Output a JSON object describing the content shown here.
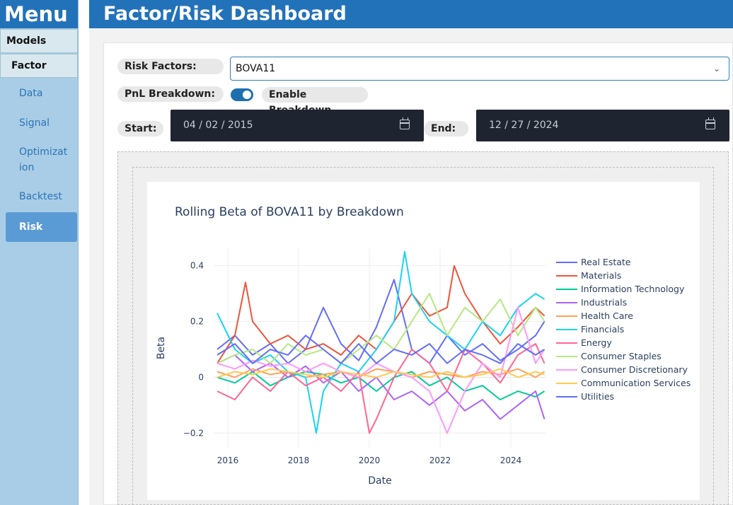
{
  "sidebar": {
    "menu_title": "Menu",
    "models_label": "Models",
    "factor_label": "Factor",
    "items": [
      {
        "label": "Data"
      },
      {
        "label": "Signal"
      },
      {
        "label": "Optimizat\nion"
      },
      {
        "label": "Backtest"
      }
    ],
    "active_item": "Risk"
  },
  "header": {
    "title": "Factor/Risk Dashboard"
  },
  "controls": {
    "risk_factors_label": "Risk Factors:",
    "risk_factor_value": "BOVA11",
    "pnl_label": "PnL Breakdown:",
    "enable_label": "Enable Breakdown",
    "toggle_on": true,
    "start_label": "Start:",
    "start_value": "04 / 02 / 2015",
    "end_label": "End:",
    "end_value": "12 / 27 / 2024"
  },
  "icons": {
    "select": "chevron-down-icon",
    "start_date": "calendar-icon",
    "end_date": "calendar-icon"
  },
  "colors": {
    "accent": "#2272b9",
    "sidebar": "#a9cde6",
    "active_item": "#5b9bd5",
    "date_input": "#1f2530"
  },
  "chart_data": {
    "type": "line",
    "title": "Rolling Beta of BOVA11 by Breakdown",
    "xlabel": "Date",
    "ylabel": "Beta",
    "xlim": [
      2015.6,
      2025.0
    ],
    "ylim": [
      -0.25,
      0.46
    ],
    "x_ticks": [
      2016,
      2018,
      2020,
      2022,
      2024
    ],
    "y_ticks": [
      0.4,
      0.2,
      0,
      -0.2
    ],
    "y_tick_labels": [
      "0.4",
      "0.2",
      "0",
      "−0.2"
    ],
    "grid": true,
    "legend_position": "right",
    "series": [
      {
        "name": "Real Estate",
        "color": "#636efa",
        "x": [
          2015.7,
          2016.2,
          2016.7,
          2017.2,
          2017.7,
          2018.2,
          2018.7,
          2019.2,
          2019.7,
          2020.2,
          2020.7,
          2021.2,
          2021.7,
          2022.2,
          2022.7,
          2023.2,
          2023.7,
          2024.2,
          2024.7,
          2024.95
        ],
        "values": [
          0.1,
          0.15,
          0.08,
          0.12,
          0.05,
          0.1,
          0.25,
          0.12,
          0.06,
          0.18,
          0.35,
          0.1,
          0.05,
          0.15,
          0.08,
          0.12,
          0.06,
          0.1,
          0.15,
          0.2
        ]
      },
      {
        "name": "Materials",
        "color": "#ef553b",
        "x": [
          2015.7,
          2016.2,
          2016.5,
          2016.7,
          2017.2,
          2017.7,
          2018.2,
          2018.7,
          2019.2,
          2019.7,
          2020.2,
          2020.7,
          2021.2,
          2021.7,
          2022.2,
          2022.4,
          2022.7,
          2023.2,
          2023.7,
          2024.2,
          2024.7,
          2024.95
        ],
        "values": [
          0.05,
          0.15,
          0.34,
          0.2,
          0.12,
          0.15,
          0.1,
          0.12,
          0.08,
          0.15,
          0.1,
          0.2,
          0.3,
          0.22,
          0.25,
          0.4,
          0.3,
          0.2,
          0.12,
          0.18,
          0.25,
          0.22
        ]
      },
      {
        "name": "Information Technology",
        "color": "#00cc96",
        "x": [
          2015.7,
          2016.2,
          2016.7,
          2017.2,
          2017.7,
          2018.2,
          2018.7,
          2019.2,
          2019.7,
          2020.2,
          2020.7,
          2021.2,
          2021.7,
          2022.2,
          2022.7,
          2023.2,
          2023.7,
          2024.2,
          2024.7,
          2024.95
        ],
        "values": [
          0.0,
          -0.02,
          0.02,
          -0.03,
          0.0,
          0.02,
          0.01,
          -0.02,
          0.0,
          -0.05,
          0.0,
          0.02,
          -0.03,
          0.0,
          -0.05,
          -0.03,
          -0.08,
          -0.05,
          -0.07,
          -0.05
        ]
      },
      {
        "name": "Industrials",
        "color": "#ab63fa",
        "x": [
          2015.7,
          2016.2,
          2016.7,
          2017.2,
          2017.7,
          2018.2,
          2018.7,
          2019.2,
          2019.7,
          2020.2,
          2020.7,
          2021.2,
          2021.7,
          2022.2,
          2022.7,
          2023.2,
          2023.7,
          2024.2,
          2024.7,
          2024.95
        ],
        "values": [
          0.05,
          0.08,
          0.02,
          0.05,
          0.0,
          0.04,
          -0.02,
          0.02,
          -0.05,
          0.0,
          -0.08,
          -0.05,
          -0.1,
          -0.05,
          -0.12,
          -0.08,
          -0.15,
          -0.1,
          -0.05,
          -0.15
        ]
      },
      {
        "name": "Health Care",
        "color": "#ffa15a",
        "x": [
          2015.7,
          2016.2,
          2016.7,
          2017.2,
          2017.7,
          2018.2,
          2018.7,
          2019.2,
          2019.7,
          2020.2,
          2020.7,
          2021.2,
          2021.7,
          2022.2,
          2022.7,
          2023.2,
          2023.7,
          2024.2,
          2024.7,
          2024.95
        ],
        "values": [
          0.02,
          0.0,
          0.03,
          0.01,
          0.02,
          0.0,
          0.01,
          0.02,
          0.0,
          0.03,
          0.02,
          0.0,
          0.02,
          0.01,
          0.0,
          0.02,
          0.01,
          0.03,
          0.0,
          0.02
        ]
      },
      {
        "name": "Financials",
        "color": "#19d3f3",
        "x": [
          2015.7,
          2016.2,
          2016.7,
          2017.2,
          2017.7,
          2018.2,
          2018.5,
          2018.7,
          2019.2,
          2019.7,
          2020.2,
          2020.7,
          2021.0,
          2021.2,
          2021.7,
          2022.2,
          2022.7,
          2023.2,
          2023.7,
          2024.2,
          2024.7,
          2024.95
        ],
        "values": [
          0.23,
          0.1,
          0.05,
          0.08,
          0.02,
          0.0,
          -0.2,
          -0.05,
          0.05,
          0.02,
          0.1,
          0.2,
          0.45,
          0.3,
          0.2,
          0.15,
          0.1,
          0.2,
          0.15,
          0.25,
          0.3,
          0.28
        ]
      },
      {
        "name": "Energy",
        "color": "#ff6692",
        "x": [
          2015.7,
          2016.2,
          2016.7,
          2017.2,
          2017.7,
          2018.2,
          2018.7,
          2019.2,
          2019.7,
          2020.0,
          2020.2,
          2020.7,
          2021.2,
          2021.7,
          2022.2,
          2022.7,
          2023.2,
          2023.7,
          2024.2,
          2024.7,
          2024.95
        ],
        "values": [
          -0.05,
          -0.08,
          0.0,
          -0.05,
          0.02,
          -0.03,
          0.0,
          -0.05,
          0.02,
          -0.2,
          -0.15,
          0.0,
          0.1,
          0.05,
          -0.05,
          0.1,
          0.05,
          -0.02,
          0.08,
          0.12,
          0.05
        ]
      },
      {
        "name": "Consumer Staples",
        "color": "#b6e880",
        "x": [
          2015.7,
          2016.2,
          2016.7,
          2017.2,
          2017.7,
          2018.2,
          2018.7,
          2019.2,
          2019.7,
          2020.2,
          2020.7,
          2021.2,
          2021.7,
          2022.2,
          2022.7,
          2023.2,
          2023.7,
          2024.2,
          2024.7,
          2024.95
        ],
        "values": [
          0.05,
          0.08,
          0.1,
          0.05,
          0.12,
          0.08,
          0.1,
          0.05,
          0.1,
          0.15,
          0.1,
          0.2,
          0.3,
          0.15,
          0.25,
          0.2,
          0.28,
          0.15,
          0.25,
          0.2
        ]
      },
      {
        "name": "Consumer Discretionary",
        "color": "#ff97ff",
        "x": [
          2015.7,
          2016.2,
          2016.7,
          2017.2,
          2017.7,
          2018.2,
          2018.7,
          2019.2,
          2019.7,
          2020.2,
          2020.7,
          2021.2,
          2021.7,
          2022.2,
          2022.7,
          2023.2,
          2023.7,
          2024.2,
          2024.7,
          2024.95
        ],
        "values": [
          0.05,
          0.03,
          0.06,
          0.04,
          0.05,
          0.02,
          0.05,
          0.02,
          0.0,
          0.05,
          0.02,
          0.0,
          -0.05,
          -0.2,
          -0.05,
          0.05,
          0.0,
          0.25,
          0.05,
          0.1
        ]
      },
      {
        "name": "Communication Services",
        "color": "#fecb52",
        "x": [
          2015.7,
          2016.2,
          2016.7,
          2017.2,
          2017.7,
          2018.2,
          2018.7,
          2019.2,
          2019.7,
          2020.2,
          2020.7,
          2021.2,
          2021.7,
          2022.2,
          2022.7,
          2023.2,
          2023.7,
          2024.2,
          2024.7,
          2024.95
        ],
        "values": [
          0.0,
          0.02,
          0.01,
          0.03,
          0.02,
          0.01,
          0.0,
          0.02,
          0.01,
          0.0,
          0.02,
          0.01,
          0.0,
          0.02,
          0.0,
          0.01,
          0.03,
          0.0,
          0.02,
          0.01
        ]
      },
      {
        "name": "Utilities",
        "color": "#636efa",
        "x": [
          2015.7,
          2016.2,
          2016.7,
          2017.2,
          2017.7,
          2018.2,
          2018.7,
          2019.2,
          2019.7,
          2020.2,
          2020.7,
          2021.2,
          2021.7,
          2022.2,
          2022.7,
          2023.2,
          2023.7,
          2024.2,
          2024.7,
          2024.95
        ],
        "values": [
          0.08,
          0.12,
          0.05,
          0.1,
          0.08,
          0.15,
          0.1,
          0.05,
          0.12,
          0.05,
          0.1,
          0.08,
          0.12,
          0.05,
          0.1,
          0.08,
          0.05,
          0.12,
          0.08,
          0.1
        ]
      }
    ]
  }
}
